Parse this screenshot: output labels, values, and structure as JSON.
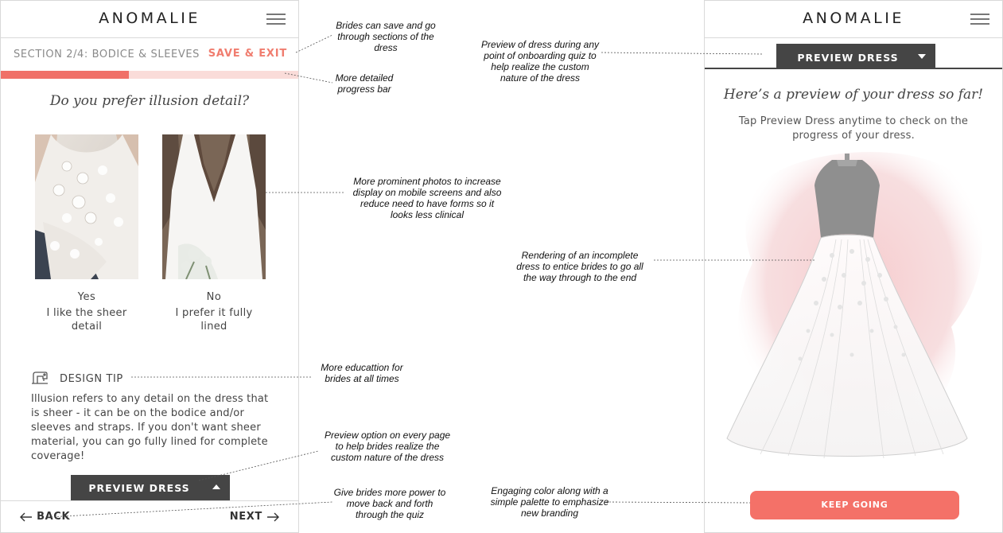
{
  "brand": "ANOMALIE",
  "quiz": {
    "section_title": "SECTION 2/4: BODICE & SLEEVES",
    "save_exit": "SAVE & EXIT",
    "progress": 0.43,
    "question": "Do you prefer illusion detail?",
    "options": [
      {
        "title": "Yes",
        "desc": "I like the sheer detail"
      },
      {
        "title": "No",
        "desc": "I prefer it fully lined"
      }
    ],
    "tip_label": "DESIGN TIP",
    "tip_body": "Illusion refers to any detail on the dress that is sheer - it can be on the bodice and/or sleeves and straps. If you don't want sheer material, you can go fully lined for complete coverage!",
    "preview_label": "PREVIEW DRESS",
    "back": "BACK",
    "next": "NEXT"
  },
  "preview": {
    "tab_label": "PREVIEW DRESS",
    "heading": "Here’s a preview of your dress so far!",
    "subtext": "Tap Preview Dress anytime to check on the progress of your dress.",
    "cta": "KEEP GOING"
  },
  "annotations": [
    "Brides can save and go through sections of the dress",
    "More detailed progress bar",
    "More prominent photos to increase display on mobile screens and also reduce need to have forms so it looks less clinical",
    "More educattion for brides at all times",
    "Preview option on every page to help brides realize the custom nature of the dress",
    "Give brides more power to move back and forth through the quiz",
    "Preview of dress during any point of onboarding quiz to help realize the custom nature of the dress",
    "Rendering of an incomplete dress to entice brides to go all the way through to the end",
    "Engaging color along with a simple palette to emphasize new branding"
  ],
  "colors": {
    "accent": "#f07068",
    "progress_track": "#fadcd9",
    "button_dark": "#454545",
    "cta": "#f47168"
  },
  "icons": [
    "hamburger-icon",
    "sewing-machine-icon",
    "caret-up-icon",
    "caret-down-icon",
    "arrow-left-icon",
    "arrow-right-icon"
  ]
}
